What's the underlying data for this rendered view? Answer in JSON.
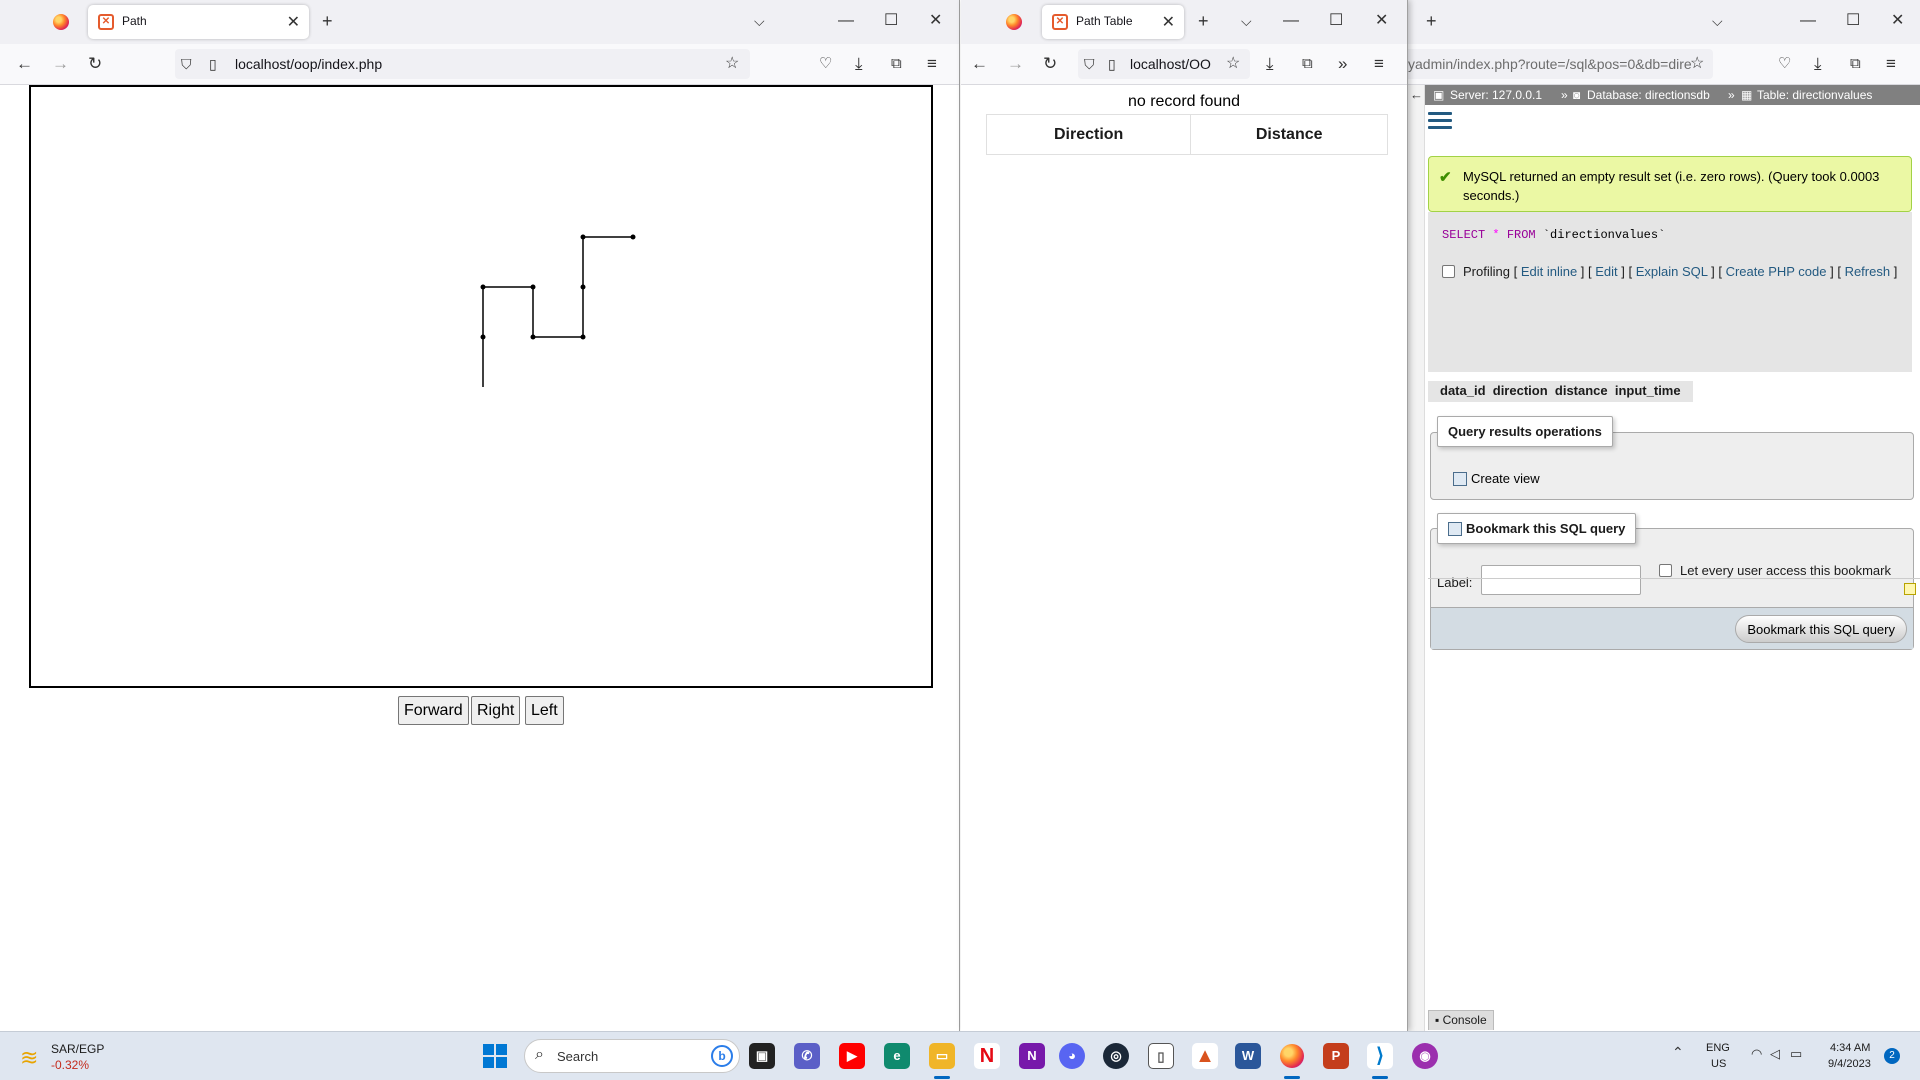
{
  "win1": {
    "tab_title": "Path",
    "url": "localhost/oop/index.php",
    "buttons": {
      "forward": "Forward",
      "right": "Right",
      "left": "Left"
    }
  },
  "win2": {
    "tab_title": "Path Table",
    "url": "localhost/OO",
    "message": "no record found",
    "table_headers": [
      "Direction",
      "Distance"
    ]
  },
  "win3": {
    "url": "yadmin/index.php?route=/sql&pos=0&db=dire",
    "breadcrumb": {
      "server": "Server: 127.0.0.1",
      "database": "Database: directionsdb",
      "table": "Table: directionvalues"
    },
    "success_message": "MySQL returned an empty result set (i.e. zero rows). (Query took 0.0003 seconds.)",
    "sql": {
      "keyword1": "SELECT",
      "star": "*",
      "keyword2": "FROM",
      "table": "`directionvalues`"
    },
    "profiling": {
      "label": "Profiling",
      "links": [
        "Edit inline",
        "Edit",
        "Explain SQL",
        "Create PHP code",
        "Refresh"
      ]
    },
    "columns": [
      "data_id",
      "direction",
      "distance",
      "input_time"
    ],
    "query_ops": {
      "legend": "Query results operations",
      "create_view": "Create view"
    },
    "bookmark": {
      "legend": "Bookmark this SQL query",
      "label": "Label:",
      "label_value": "",
      "access": "Let every user access this bookmark",
      "button": "Bookmark this SQL query"
    },
    "console": "Console"
  },
  "taskbar": {
    "widget_pair": "SAR/EGP",
    "widget_change": "-0.32%",
    "search_placeholder": "Search",
    "lang_line1": "ENG",
    "lang_line2": "US",
    "time": "4:34 AM",
    "date": "9/4/2023",
    "notifications": "2"
  },
  "colors": {
    "accent": "#0067c0",
    "pma_link": "#235a81",
    "success_bg": "#ebf8a4",
    "negative": "#c42b1c"
  }
}
